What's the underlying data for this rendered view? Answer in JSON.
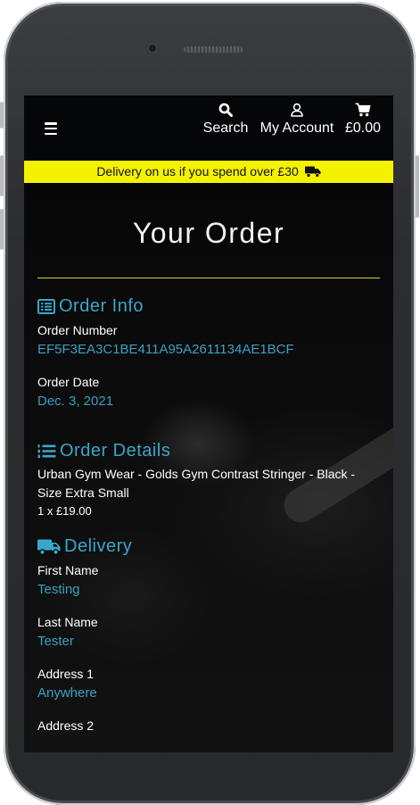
{
  "nav": {
    "search_label": "Search",
    "account_label": "My Account",
    "cart_total": "£0.00"
  },
  "promo": {
    "text": "Delivery on us if you spend over £30"
  },
  "page": {
    "title": "Your Order"
  },
  "order_info": {
    "heading": "Order Info",
    "order_number_label": "Order Number",
    "order_number": "EF5F3EA3C1BE411A95A2611134AE1BCF",
    "order_date_label": "Order Date",
    "order_date": "Dec. 3, 2021"
  },
  "order_details": {
    "heading": "Order Details",
    "product": "Urban Gym Wear - Golds Gym Contrast Stringer - Black - Size Extra Small",
    "quantity_price": "1 x £19.00"
  },
  "delivery": {
    "heading": "Delivery",
    "first_name_label": "First Name",
    "first_name": "Testing",
    "last_name_label": "Last Name",
    "last_name": "Tester",
    "address1_label": "Address 1",
    "address1": "Anywhere",
    "address2_label": "Address 2"
  },
  "colors": {
    "accent": "#3aa7c8",
    "promo_bg": "#f5f200",
    "rule": "#d9c84a"
  }
}
